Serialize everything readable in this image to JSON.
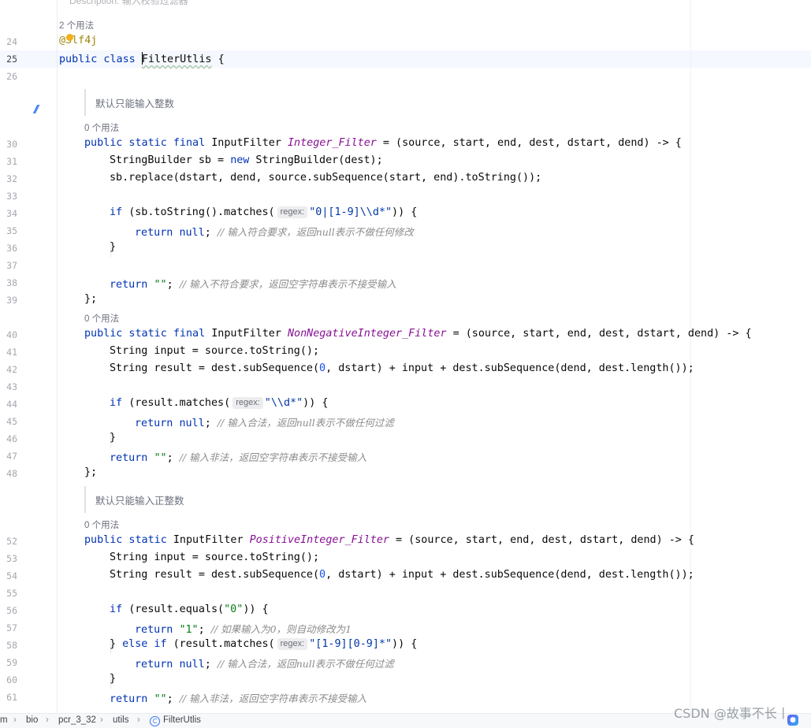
{
  "top_partial_text": "Description: 输入校验过滤器",
  "class_usage": "2 个用法",
  "annotation": "@Slf4j",
  "class_decl": {
    "kw": "public class",
    "name": "FilterUtlis",
    "brace": "{"
  },
  "line_numbers": [
    "24",
    "25",
    "26",
    "30",
    "31",
    "32",
    "33",
    "34",
    "35",
    "36",
    "37",
    "38",
    "39",
    "40",
    "41",
    "42",
    "43",
    "44",
    "45",
    "46",
    "47",
    "48",
    "52",
    "53",
    "54",
    "55",
    "56",
    "57",
    "58",
    "59",
    "60",
    "61"
  ],
  "docs": [
    "默认只能输入整数",
    "默认只能输入正整数"
  ],
  "usages": [
    "0 个用法",
    "0 个用法",
    "0 个用法"
  ],
  "regex_hint": "regex:",
  "block1": {
    "decl_kw": "public static final",
    "type": "InputFilter",
    "name": "Integer_Filter",
    "params": " = (source, start, end, dest, dstart, dend) -> {",
    "l31": "StringBuilder sb = ",
    "l31_kw": "new",
    "l31_rest": " StringBuilder(dest);",
    "l32": "sb.replace(dstart, dend, source.subSequence(start, end).toString());",
    "l34_pre": "(sb.toString().matches(",
    "l34_regex": "\"0|[1-9]\\\\d*\"",
    "l34_post": ")) {",
    "l35_val": "null",
    "l35_cmt": "// 输入符合要求，返回null表示不做任何修改",
    "l38_str": "\"\"",
    "l38_cmt": "// 输入不符合要求，返回空字符串表示不接受输入"
  },
  "block2": {
    "decl_kw": "public static final",
    "type": "InputFilter",
    "name": "NonNegativeInteger_Filter",
    "params": " = (source, start, end, dest, dstart, dend) -> {",
    "l41": "String input = source.toString();",
    "l42_a": "String result = dest.subSequence(",
    "l42_num": "0",
    "l42_b": ", dstart) + input + dest.subSequence(dend, dest.length());",
    "l44_pre": "(result.matches(",
    "l44_regex": "\"\\\\d*\"",
    "l44_post": ")) {",
    "l45_val": "null",
    "l45_cmt": "// 输入合法，返回null表示不做任何过滤",
    "l47_str": "\"\"",
    "l47_cmt": "// 输入非法，返回空字符串表示不接受输入"
  },
  "block3": {
    "decl_kw": "public static",
    "type": "InputFilter",
    "name": "PositiveInteger_Filter",
    "params": " = (source, start, end, dest, dstart, dend) -> {",
    "l53": "String input = source.toString();",
    "l54_a": "String result = dest.subSequence(",
    "l54_num": "0",
    "l54_b": ", dstart) + input + dest.subSequence(dend, dest.length());",
    "l56_pre": "(result.equals(",
    "l56_str": "\"0\"",
    "l56_post": ")) {",
    "l57_str": "\"1\"",
    "l57_cmt": "// 如果输入为0，则自动修改为1",
    "l58_pre": "(result.matches(",
    "l58_regex": "\"[1-9][0-9]*\"",
    "l58_post": ")) {",
    "l59_val": "null",
    "l59_cmt": "// 输入合法，返回null表示不做任何过滤",
    "l61_str": "\"\"",
    "l61_cmt": "// 输入非法，返回空字符串表示不接受输入"
  },
  "breadcrumbs": [
    "m",
    "bio",
    "pcr_3_32",
    "utils",
    "FilterUtlis"
  ],
  "watermark": "CSDN @故事不长丨"
}
